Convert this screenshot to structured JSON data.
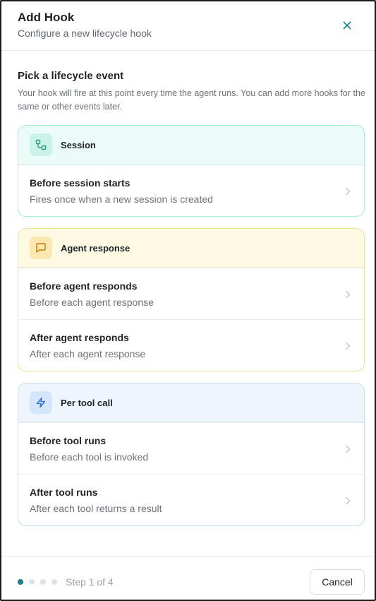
{
  "header": {
    "title": "Add Hook",
    "subtitle": "Configure a new lifecycle hook",
    "close_icon": "close-icon"
  },
  "intro": {
    "title": "Pick a lifecycle event",
    "description": "Your hook will fire at this point every time the agent runs. You can add more hooks for the same or other events later."
  },
  "groups": [
    {
      "label": "Session",
      "icon": "workflow-icon",
      "accent": "#2f9b83",
      "items": [
        {
          "title": "Before session starts",
          "description": "Fires once when a new session is created"
        }
      ]
    },
    {
      "label": "Agent response",
      "icon": "message-square-icon",
      "accent": "#c27a12",
      "items": [
        {
          "title": "Before agent responds",
          "description": "Before each agent response"
        },
        {
          "title": "After agent responds",
          "description": "After each agent response"
        }
      ]
    },
    {
      "label": "Per tool call",
      "icon": "zap-icon",
      "accent": "#2d6fd1",
      "items": [
        {
          "title": "Before tool runs",
          "description": "Before each tool is invoked"
        },
        {
          "title": "After tool runs",
          "description": "After each tool returns a result"
        }
      ]
    }
  ],
  "footer": {
    "step_text": "Step 1 of 4",
    "current_step": 1,
    "total_steps": 4,
    "cancel_label": "Cancel"
  },
  "colors": {
    "accent": "#1a7f8e"
  }
}
